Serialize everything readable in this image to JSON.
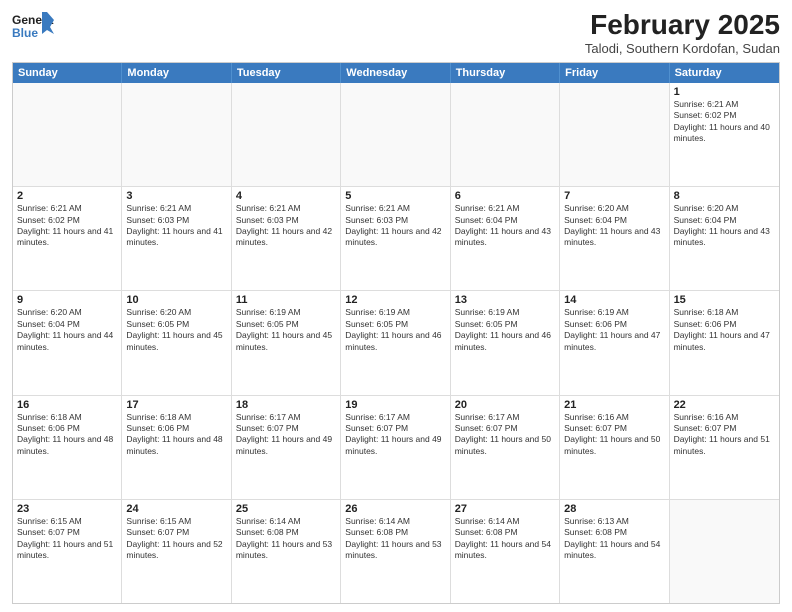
{
  "logo": {
    "line1": "General",
    "line2": "Blue"
  },
  "title": "February 2025",
  "subtitle": "Talodi, Southern Kordofan, Sudan",
  "days_of_week": [
    "Sunday",
    "Monday",
    "Tuesday",
    "Wednesday",
    "Thursday",
    "Friday",
    "Saturday"
  ],
  "weeks": [
    [
      {
        "day": "",
        "empty": true
      },
      {
        "day": "",
        "empty": true
      },
      {
        "day": "",
        "empty": true
      },
      {
        "day": "",
        "empty": true
      },
      {
        "day": "",
        "empty": true
      },
      {
        "day": "",
        "empty": true
      },
      {
        "day": "1",
        "sunrise": "6:21 AM",
        "sunset": "6:02 PM",
        "daylight": "11 hours and 40 minutes."
      }
    ],
    [
      {
        "day": "2",
        "sunrise": "6:21 AM",
        "sunset": "6:02 PM",
        "daylight": "11 hours and 41 minutes."
      },
      {
        "day": "3",
        "sunrise": "6:21 AM",
        "sunset": "6:03 PM",
        "daylight": "11 hours and 41 minutes."
      },
      {
        "day": "4",
        "sunrise": "6:21 AM",
        "sunset": "6:03 PM",
        "daylight": "11 hours and 42 minutes."
      },
      {
        "day": "5",
        "sunrise": "6:21 AM",
        "sunset": "6:03 PM",
        "daylight": "11 hours and 42 minutes."
      },
      {
        "day": "6",
        "sunrise": "6:21 AM",
        "sunset": "6:04 PM",
        "daylight": "11 hours and 43 minutes."
      },
      {
        "day": "7",
        "sunrise": "6:20 AM",
        "sunset": "6:04 PM",
        "daylight": "11 hours and 43 minutes."
      },
      {
        "day": "8",
        "sunrise": "6:20 AM",
        "sunset": "6:04 PM",
        "daylight": "11 hours and 43 minutes."
      }
    ],
    [
      {
        "day": "9",
        "sunrise": "6:20 AM",
        "sunset": "6:04 PM",
        "daylight": "11 hours and 44 minutes."
      },
      {
        "day": "10",
        "sunrise": "6:20 AM",
        "sunset": "6:05 PM",
        "daylight": "11 hours and 45 minutes."
      },
      {
        "day": "11",
        "sunrise": "6:19 AM",
        "sunset": "6:05 PM",
        "daylight": "11 hours and 45 minutes."
      },
      {
        "day": "12",
        "sunrise": "6:19 AM",
        "sunset": "6:05 PM",
        "daylight": "11 hours and 46 minutes."
      },
      {
        "day": "13",
        "sunrise": "6:19 AM",
        "sunset": "6:05 PM",
        "daylight": "11 hours and 46 minutes."
      },
      {
        "day": "14",
        "sunrise": "6:19 AM",
        "sunset": "6:06 PM",
        "daylight": "11 hours and 47 minutes."
      },
      {
        "day": "15",
        "sunrise": "6:18 AM",
        "sunset": "6:06 PM",
        "daylight": "11 hours and 47 minutes."
      }
    ],
    [
      {
        "day": "16",
        "sunrise": "6:18 AM",
        "sunset": "6:06 PM",
        "daylight": "11 hours and 48 minutes."
      },
      {
        "day": "17",
        "sunrise": "6:18 AM",
        "sunset": "6:06 PM",
        "daylight": "11 hours and 48 minutes."
      },
      {
        "day": "18",
        "sunrise": "6:17 AM",
        "sunset": "6:07 PM",
        "daylight": "11 hours and 49 minutes."
      },
      {
        "day": "19",
        "sunrise": "6:17 AM",
        "sunset": "6:07 PM",
        "daylight": "11 hours and 49 minutes."
      },
      {
        "day": "20",
        "sunrise": "6:17 AM",
        "sunset": "6:07 PM",
        "daylight": "11 hours and 50 minutes."
      },
      {
        "day": "21",
        "sunrise": "6:16 AM",
        "sunset": "6:07 PM",
        "daylight": "11 hours and 50 minutes."
      },
      {
        "day": "22",
        "sunrise": "6:16 AM",
        "sunset": "6:07 PM",
        "daylight": "11 hours and 51 minutes."
      }
    ],
    [
      {
        "day": "23",
        "sunrise": "6:15 AM",
        "sunset": "6:07 PM",
        "daylight": "11 hours and 51 minutes."
      },
      {
        "day": "24",
        "sunrise": "6:15 AM",
        "sunset": "6:07 PM",
        "daylight": "11 hours and 52 minutes."
      },
      {
        "day": "25",
        "sunrise": "6:14 AM",
        "sunset": "6:08 PM",
        "daylight": "11 hours and 53 minutes."
      },
      {
        "day": "26",
        "sunrise": "6:14 AM",
        "sunset": "6:08 PM",
        "daylight": "11 hours and 53 minutes."
      },
      {
        "day": "27",
        "sunrise": "6:14 AM",
        "sunset": "6:08 PM",
        "daylight": "11 hours and 54 minutes."
      },
      {
        "day": "28",
        "sunrise": "6:13 AM",
        "sunset": "6:08 PM",
        "daylight": "11 hours and 54 minutes."
      },
      {
        "day": "",
        "empty": true
      }
    ]
  ]
}
